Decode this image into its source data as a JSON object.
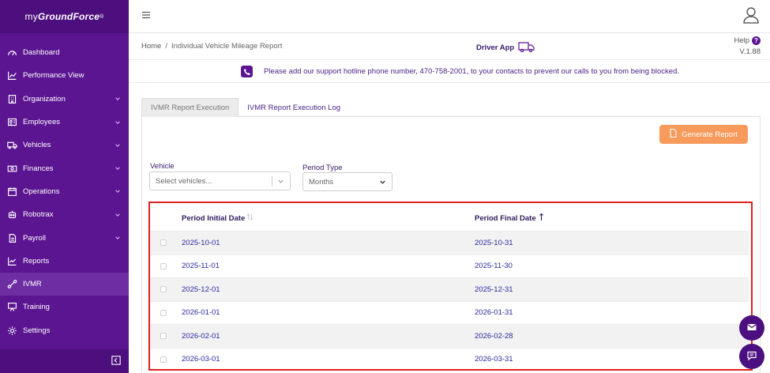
{
  "brand": {
    "prefix": "my",
    "name": "GroundForce",
    "mark": "®"
  },
  "sidebar": {
    "items": [
      {
        "label": "Dashboard",
        "icon": "gauge-icon",
        "has_chevron": false
      },
      {
        "label": "Performance View",
        "icon": "trend-chart-icon",
        "has_chevron": false
      },
      {
        "label": "Organization",
        "icon": "building-icon",
        "has_chevron": true
      },
      {
        "label": "Employees",
        "icon": "id-card-icon",
        "has_chevron": true
      },
      {
        "label": "Vehicles",
        "icon": "truck-icon",
        "has_chevron": true
      },
      {
        "label": "Finances",
        "icon": "money-icon",
        "has_chevron": true
      },
      {
        "label": "Operations",
        "icon": "calendar-icon",
        "has_chevron": true
      },
      {
        "label": "Robotrax",
        "icon": "robot-icon",
        "has_chevron": true
      },
      {
        "label": "Payroll",
        "icon": "document-icon",
        "has_chevron": true
      },
      {
        "label": "Reports",
        "icon": "line-chart-icon",
        "has_chevron": false
      },
      {
        "label": "IVMR",
        "icon": "route-icon",
        "has_chevron": false,
        "active": true
      },
      {
        "label": "Training",
        "icon": "training-icon",
        "has_chevron": false
      },
      {
        "label": "Settings",
        "icon": "gear-icon",
        "has_chevron": false
      }
    ]
  },
  "breadcrumb": {
    "home": "Home",
    "separator": "/",
    "current": "Individual Vehicle Mileage Report"
  },
  "driver_app": {
    "label": "Driver App"
  },
  "help": {
    "label": "Help",
    "version": "V.1.88"
  },
  "notice": {
    "text": "Please add our support hotline phone number, 470-758-2001, to your contacts to prevent our calls to you from being blocked."
  },
  "tabs": [
    {
      "label": "IVMR Report Execution",
      "active": true
    },
    {
      "label": "IVMR Report Execution Log",
      "active": false
    }
  ],
  "actions": {
    "generate_report": "Generate Report"
  },
  "filters": {
    "vehicle": {
      "label": "Vehicle",
      "placeholder": "Select vehicles..."
    },
    "period_type": {
      "label": "Period Type",
      "value": "Months"
    }
  },
  "table": {
    "columns": [
      "Period Initial Date",
      "Period Final Date"
    ],
    "rows": [
      {
        "initial": "2025-10-01",
        "final": "2025-10-31"
      },
      {
        "initial": "2025-11-01",
        "final": "2025-11-30"
      },
      {
        "initial": "2025-12-01",
        "final": "2025-12-31"
      },
      {
        "initial": "2026-01-01",
        "final": "2026-01-31"
      },
      {
        "initial": "2026-02-01",
        "final": "2026-02-28"
      },
      {
        "initial": "2026-03-01",
        "final": "2026-03-31"
      }
    ]
  },
  "colors": {
    "sidebar": "#5b1591",
    "accent_orange": "#f79a5b",
    "highlight_red": "#e0201e"
  }
}
